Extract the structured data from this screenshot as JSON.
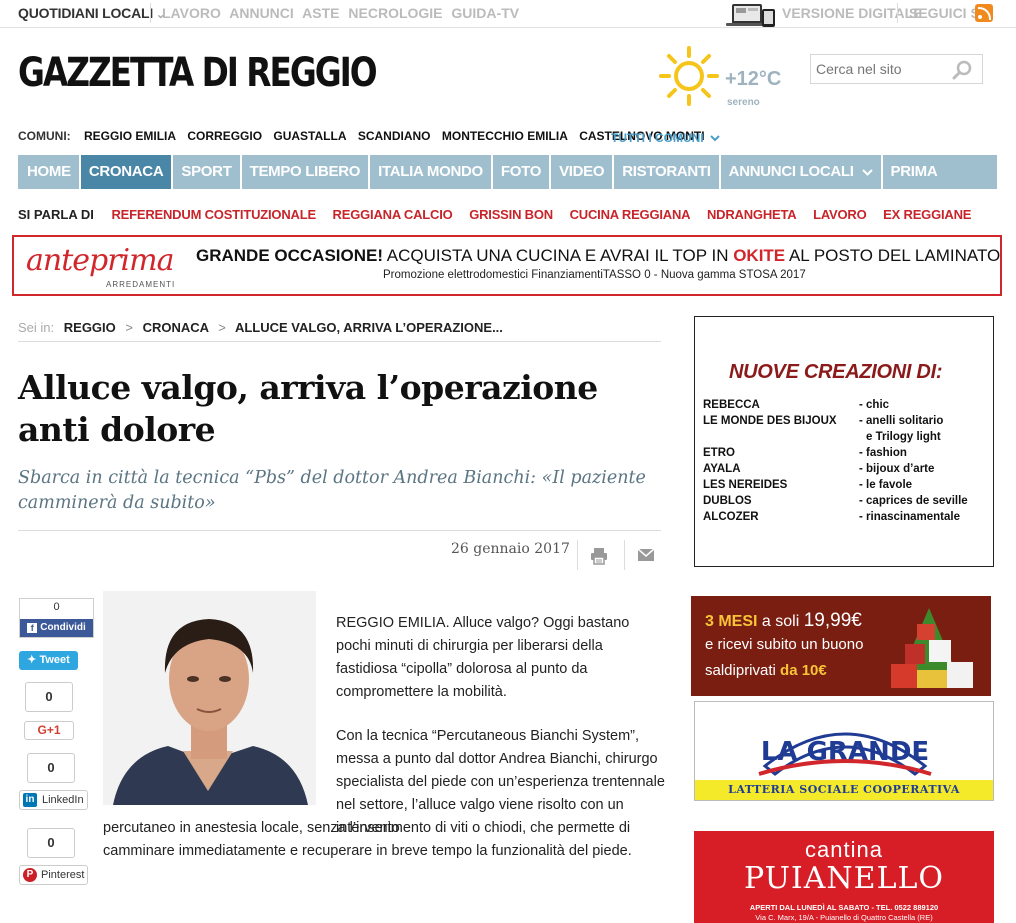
{
  "topbar": {
    "quotidiani": "QUOTIDIANI LOCALI",
    "links": [
      "LAVORO",
      "ANNUNCI",
      "ASTE",
      "NECROLOGIE",
      "GUIDA-TV"
    ],
    "digitale": "VERSIONE DIGITALE",
    "seguici": "SEGUICI SU"
  },
  "logo": "GAZZETTA DI REGGIO",
  "weather": {
    "temp": "+12°C",
    "condition": "sereno"
  },
  "search": {
    "placeholder": "Cerca nel sito"
  },
  "comuni": {
    "label": "COMUNI:",
    "items": [
      "REGGIO EMILIA",
      "CORREGGIO",
      "GUASTALLA",
      "SCANDIANO",
      "MONTECCHIO EMILIA",
      "CASTELNOVO MONTI"
    ],
    "tutti": "TUTTI I COMUNI"
  },
  "nav": {
    "items": [
      "HOME",
      "CRONACA",
      "SPORT",
      "TEMPO LIBERO",
      "ITALIA MONDO",
      "FOTO",
      "VIDEO",
      "RISTORANTI",
      "ANNUNCI LOCALI",
      "PRIMA"
    ],
    "active": "CRONACA"
  },
  "parla": {
    "label": "SI PARLA DI",
    "tags": [
      "REFERENDUM COSTITUZIONALE",
      "REGGIANA CALCIO",
      "GRISSIN BON",
      "CUCINA REGGIANA",
      "NDRANGHETA",
      "LAVORO",
      "EX REGGIANE"
    ]
  },
  "banner": {
    "brand": "anteprima",
    "brand_sub": "ARREDAMENTI",
    "head_bold": "GRANDE OCCASIONE!",
    "head_rest": " ACQUISTA UNA CUCINA E AVRAI IL TOP IN ",
    "head_red": "OKITE",
    "head_end": " AL POSTO DEL LAMINATO",
    "sub": "Promozione elettrodomestici FinanziamentiTASSO 0 - Nuova gamma STOSA 2017"
  },
  "breadcrumb": {
    "label": "Sei in:",
    "items": [
      "REGGIO",
      "CRONACA",
      "ALLUCE VALGO, ARRIVA L’OPERAZIONE..."
    ]
  },
  "article": {
    "title": "Alluce valgo, arriva l’operazione anti dolore",
    "subtitle": "Sbarca in città la tecnica “Pbs” del dottor Andrea Bianchi: «Il paziente camminerà da subito»",
    "date": "26 gennaio 2017",
    "p1": "REGGIO EMILIA. Alluce valgo? Oggi bastano pochi minuti di chirurgia per liberarsi della fastidiosa “cipolla” dolorosa al punto da compromettere la mobilità.",
    "p2": "Con la tecnica “Percutaneous Bianchi System”, messa a punto dal dottor Andrea Bianchi, chirurgo specialista del piede con un’esperienza trentennale nel settore, l’alluce valgo viene risolto con un intervento",
    "p3": "percutaneo in anestesia locale, senza l’inserimento di viti o chiodi, che permette di camminare immediatamente e recuperare in breve tempo la funzionalità del piede."
  },
  "social": {
    "fb_count": "0",
    "fb_label": "Condividi",
    "tweet": "Tweet",
    "g_count": "0",
    "g_label": "G+1",
    "li_count": "0",
    "li_label": "LinkedIn",
    "pi_count": "0",
    "pi_label": "Pinterest"
  },
  "ad_jewel": {
    "heading": "NUOVE CREAZIONI DI:",
    "rows": [
      {
        "name": "REBECCA",
        "desc": "- chic"
      },
      {
        "name": "LE MONDE DES BIJOUX",
        "desc": "- anelli solitario"
      },
      {
        "name": "",
        "desc": "e Trilogy light"
      },
      {
        "name": "ETRO",
        "desc": "- fashion"
      },
      {
        "name": "AYALA",
        "desc": "- bijoux d’arte"
      },
      {
        "name": "LES NEREIDES",
        "desc": "- le favole"
      },
      {
        "name": "DUBLOS",
        "desc": "- caprices de seville"
      },
      {
        "name": "ALCOZER",
        "desc": "- rinascinamentale"
      }
    ]
  },
  "ad_saldi": {
    "l1a": "3 MESI",
    "l1b": " a soli ",
    "l1c": "19,99€",
    "l2": "e ricevi subito un buono",
    "l3a": "saldiprivati",
    "l3b": " da 10€"
  },
  "ad_grande": {
    "brand": "LA GRANDE",
    "strip": "LATTERIA SOCIALE COOPERATIVA"
  },
  "ad_cantina": {
    "c1": "cantina",
    "c2": "PUIANELLO",
    "c3": "APERTI DAL LUNEDÌ AL SABATO - TEL. 0522 889120",
    "c4": "Via C. Marx, 19/A - Puianello di Quattro Castella (RE)"
  },
  "colors": {
    "accent": "#4a86a6",
    "nav": "#9fbfcf",
    "red": "#c8252b"
  }
}
